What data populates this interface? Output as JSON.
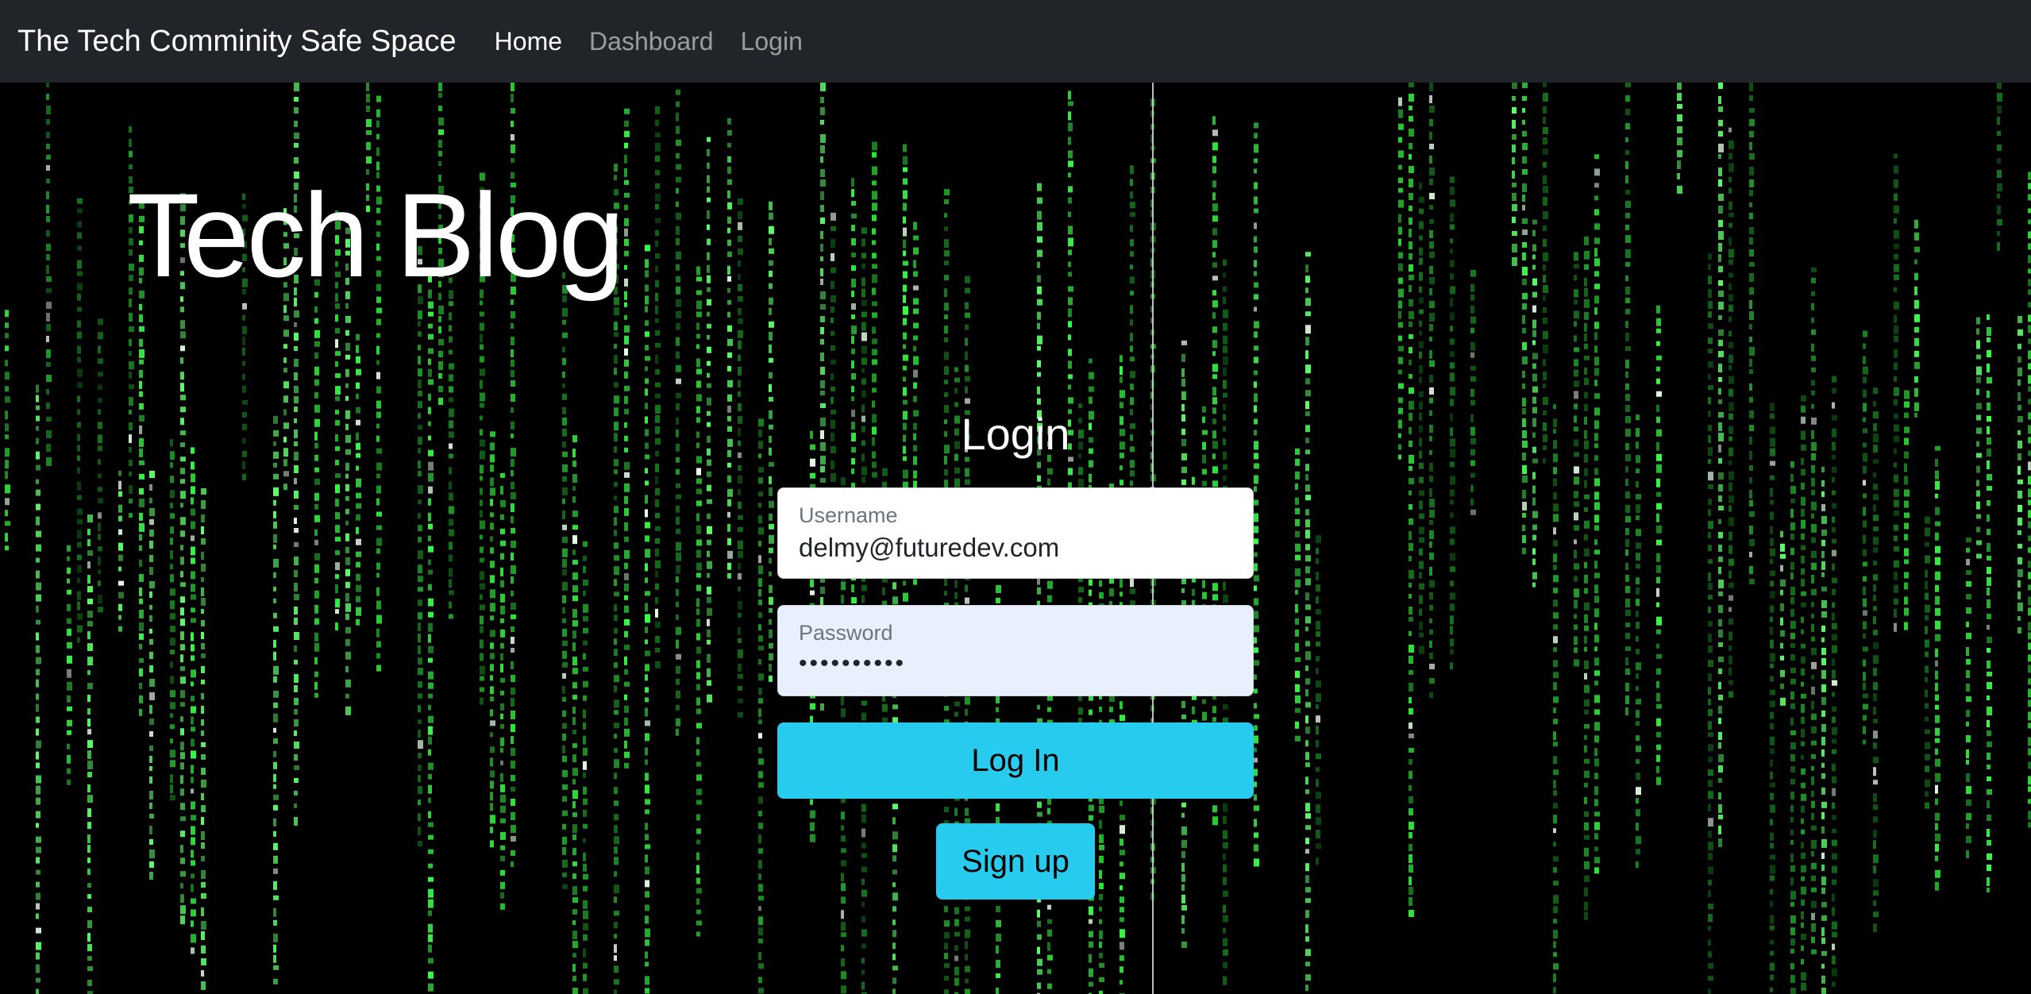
{
  "nav": {
    "brand": "The Tech Comminity Safe Space",
    "links": [
      "Home",
      "Dashboard",
      "Login"
    ],
    "active": "Home"
  },
  "hero": {
    "title": "Tech Blog"
  },
  "login": {
    "heading": "Login",
    "username_label": "Username",
    "username_value": "delmy@futuredev.com",
    "password_label": "Password",
    "password_value": "••••••••••",
    "login_button": "Log In",
    "signup_button": "Sign up"
  },
  "colors": {
    "navbar_bg": "#212529",
    "button_bg": "#27cbed",
    "rain_green": "#2ee53a",
    "autofill_bg": "#e8f0fe"
  }
}
